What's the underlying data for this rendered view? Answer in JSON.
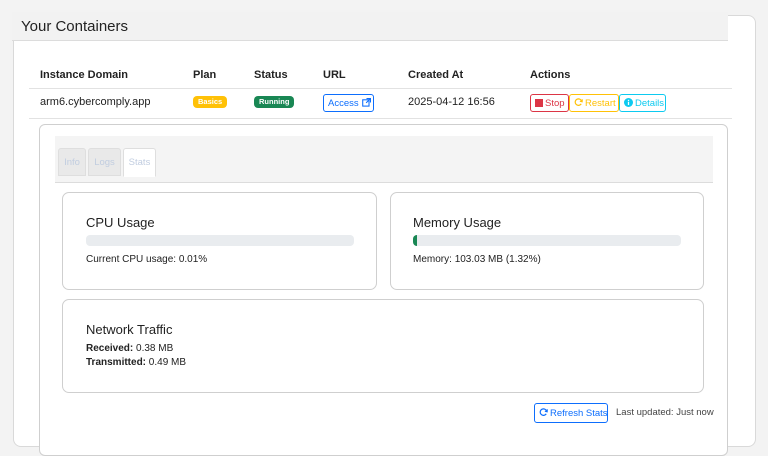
{
  "card": {
    "title": "Your Containers"
  },
  "table": {
    "headers": {
      "domain": "Instance Domain",
      "plan": "Plan",
      "status": "Status",
      "url": "URL",
      "created": "Created At",
      "actions": "Actions"
    },
    "row": {
      "domain": "arm6.cybercomply.app",
      "plan": "Basics",
      "status": "Running",
      "url_label": "Access",
      "created": "2025-04-12 16:56",
      "stop_label": "Stop",
      "restart_label": "Restart",
      "details_label": "Details"
    }
  },
  "tabs": {
    "info": "Info",
    "logs": "Logs",
    "stats": "Stats",
    "active": "stats"
  },
  "cpu": {
    "title": "CPU Usage",
    "percent": 0.01,
    "label_prefix": "Current CPU usage:",
    "value": "0.01%"
  },
  "memory": {
    "title": "Memory Usage",
    "percent": 1.32,
    "label_prefix": "Memory:",
    "value": "103.03 MB (1.32%)"
  },
  "network": {
    "title": "Network Traffic",
    "received_label": "Received:",
    "received": "0.38 MB",
    "transmitted_label": "Transmitted:",
    "transmitted": "0.49 MB"
  },
  "footer": {
    "refresh_label": "Refresh Stats",
    "last_updated": "Last updated: Just now"
  },
  "colors": {
    "plan_badge": "#ffc107",
    "status_badge": "#198754",
    "primary": "#0d6efd",
    "danger": "#dc3545",
    "warning": "#ffc107",
    "info": "#0dcaf0",
    "progress": "#198754"
  },
  "icons": {
    "url": "external-link-icon",
    "stop": "stop-square-icon",
    "restart": "refresh-icon",
    "details": "info-circle-icon",
    "refresh": "refresh-icon"
  }
}
